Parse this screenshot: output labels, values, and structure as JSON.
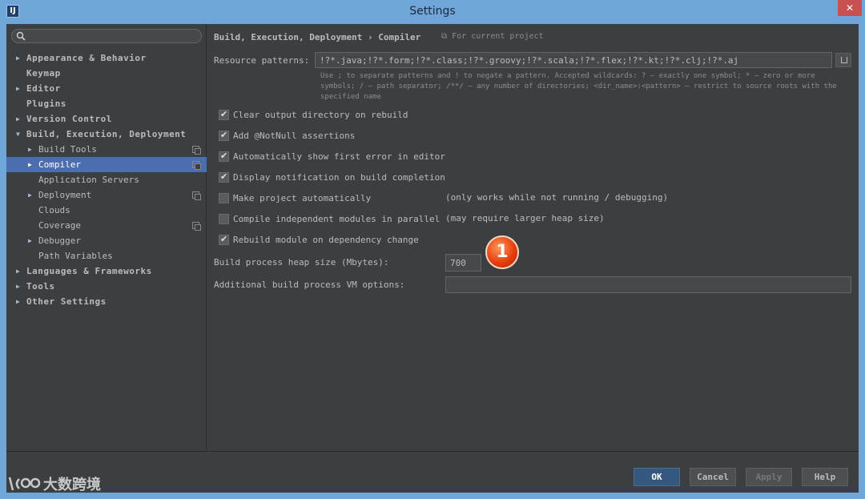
{
  "window": {
    "title": "Settings",
    "app_icon_glyph": "IJ",
    "close_glyph": "✕"
  },
  "sidebar": {
    "search": {
      "value": "",
      "placeholder": ""
    },
    "items": [
      {
        "label": "Appearance & Behavior",
        "arrow": "▶"
      },
      {
        "label": "Keymap",
        "arrow": ""
      },
      {
        "label": "Editor",
        "arrow": "▶"
      },
      {
        "label": "Plugins",
        "arrow": ""
      },
      {
        "label": "Version Control",
        "arrow": "▶"
      },
      {
        "label": "Build, Execution, Deployment",
        "arrow": "▼"
      },
      {
        "label": "Build Tools",
        "arrow": "▶"
      },
      {
        "label": "Compiler",
        "arrow": "▶"
      },
      {
        "label": "Application Servers",
        "arrow": ""
      },
      {
        "label": "Deployment",
        "arrow": "▶"
      },
      {
        "label": "Clouds",
        "arrow": ""
      },
      {
        "label": "Coverage",
        "arrow": ""
      },
      {
        "label": "Debugger",
        "arrow": "▶"
      },
      {
        "label": "Path Variables",
        "arrow": ""
      },
      {
        "label": "Languages & Frameworks",
        "arrow": "▶"
      },
      {
        "label": "Tools",
        "arrow": "▶"
      },
      {
        "label": "Other Settings",
        "arrow": "▶"
      }
    ]
  },
  "main": {
    "breadcrumb": "Build, Execution, Deployment › Compiler",
    "breadcrumb_extra": "For current project",
    "resource_patterns": {
      "label": "Resource patterns:",
      "value": "!?*.java;!?*.form;!?*.class;!?*.groovy;!?*.scala;!?*.flex;!?*.kt;!?*.clj;!?*.aj",
      "hint": "Use ; to separate patterns and ! to negate a pattern. Accepted wildcards: ? — exactly one symbol; * — zero or more symbols; / — path separator; /**/ — any number of directories; <dir_name>:<pattern> — restrict to source roots with the specified name"
    },
    "checkboxes": [
      {
        "label": "Clear output directory on rebuild",
        "checked": true,
        "note": ""
      },
      {
        "label": "Add @NotNull assertions",
        "checked": true,
        "note": ""
      },
      {
        "label": "Automatically show first error in editor",
        "checked": true,
        "note": ""
      },
      {
        "label": "Display notification on build completion",
        "checked": true,
        "note": ""
      },
      {
        "label": "Make project automatically",
        "checked": false,
        "note": "(only works while not running / debugging)"
      },
      {
        "label": "Compile independent modules in parallel",
        "checked": false,
        "note": "(may require larger heap size)"
      },
      {
        "label": "Rebuild module on dependency change",
        "checked": true,
        "note": ""
      }
    ],
    "heap_size": {
      "label": "Build process heap size (Mbytes):",
      "value": "700"
    },
    "vm_options": {
      "label": "Additional build process VM options:",
      "value": ""
    },
    "callout_badge": "1"
  },
  "footer": {
    "ok": "OK",
    "cancel": "Cancel",
    "apply": "Apply",
    "help": "Help"
  },
  "watermark": {
    "text": "大数跨境"
  },
  "colors": {
    "selection": "#4b6eaf",
    "background": "#3c3f41",
    "titlebar": "#6fa5d8",
    "badge": "#e83e10"
  }
}
